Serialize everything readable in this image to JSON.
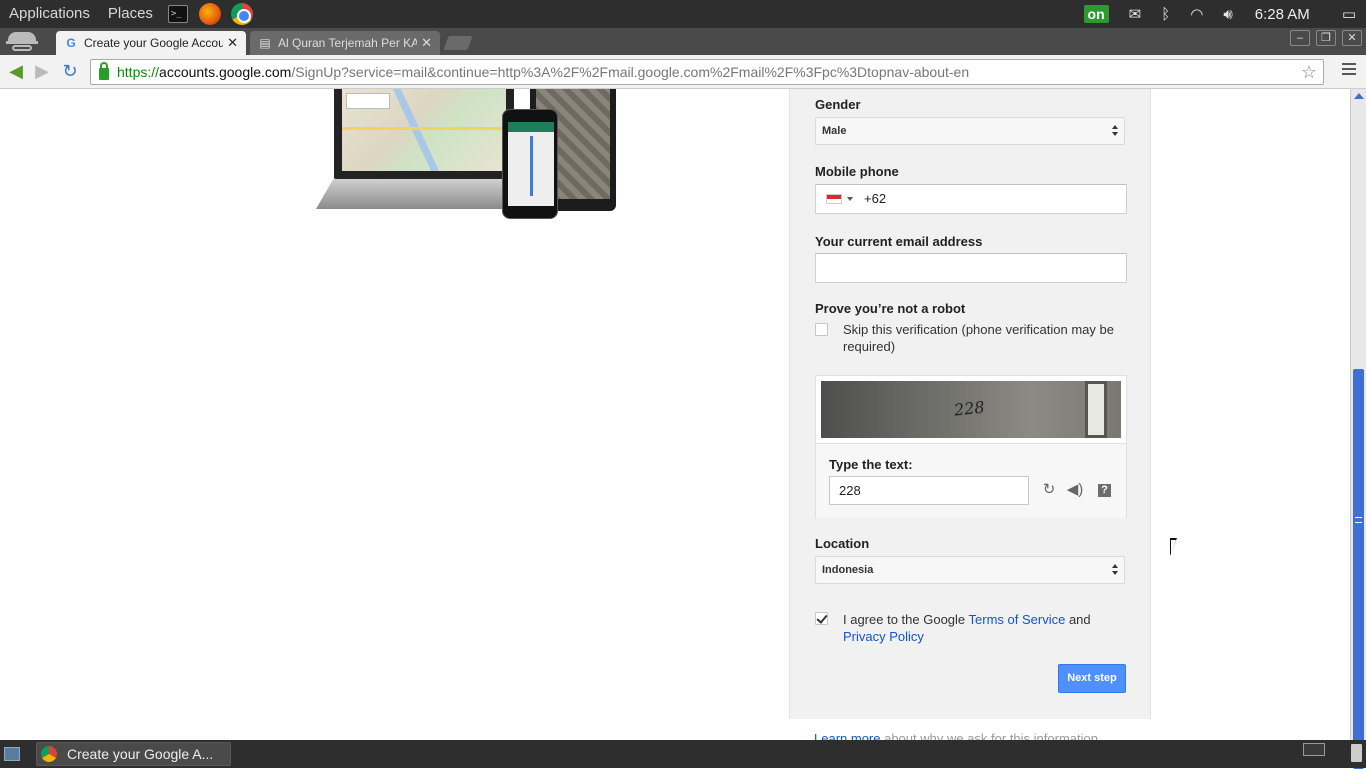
{
  "desktop": {
    "menu_applications": "Applications",
    "menu_places": "Places",
    "tray_on": "on",
    "clock": "6:28 AM"
  },
  "browser": {
    "tabs": [
      {
        "title": "Create your Google Accou",
        "favicon": "G"
      },
      {
        "title": "Al Quran Terjemah Per KA",
        "favicon": "page-icon"
      }
    ],
    "url_https": "https://",
    "url_host": "accounts.google.com",
    "url_rest": "/SignUp?service=mail&continue=http%3A%2F%2Fmail.google.com%2Fmail%2F%3Fpc%3Dtopnav-about-en"
  },
  "form": {
    "gender_label": "Gender",
    "gender_value": "Male",
    "mobile_label": "Mobile phone",
    "mobile_value": "+62",
    "email_label": "Your current email address",
    "email_value": "",
    "robot_label": "Prove you’re not a robot",
    "skip_text": "Skip this verification (phone verification may be required)",
    "captcha_image_text": "228",
    "captcha_label": "Type the text:",
    "captcha_value": "228",
    "captcha_help": "?",
    "location_label": "Location",
    "location_value": "Indonesia",
    "agree_prefix": "I agree to the Google ",
    "agree_tos": "Terms of Service",
    "agree_and": " and",
    "agree_privacy": "Privacy Policy",
    "next_button": "Next step",
    "learn_more": "Learn more",
    "learn_more_rest": " about why we ask for this information"
  },
  "taskbar": {
    "task_label": "Create your Google A..."
  },
  "colors": {
    "accent": "#4d90fe",
    "link": "#1155cc",
    "panel": "#2e2e2e"
  }
}
